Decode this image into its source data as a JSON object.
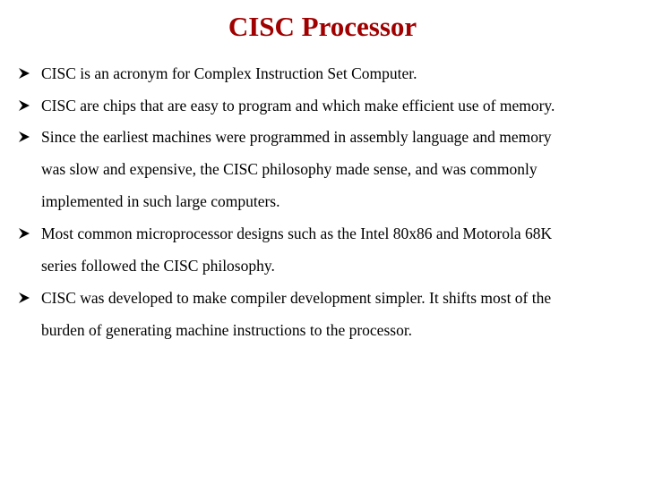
{
  "slide": {
    "title": "CISC Processor",
    "title_color": "#a00000",
    "bullet_icon": "arrowhead-bullet-icon",
    "bullets": [
      {
        "lines": [
          "CISC is an acronym for Complex Instruction Set Computer."
        ]
      },
      {
        "lines": [
          "CISC are chips that are easy to program and which make efficient use of memory."
        ]
      },
      {
        "lines": [
          "Since the earliest machines were programmed in assembly language and memory",
          "was slow and expensive, the CISC philosophy made sense, and was commonly",
          "implemented in such large computers."
        ]
      },
      {
        "lines": [
          "Most common microprocessor designs such as the Intel 80x86 and Motorola 68K",
          "series followed the CISC philosophy."
        ]
      },
      {
        "lines": [
          "CISC was developed to make compiler development simpler. It shifts most of the",
          "burden of generating machine instructions to the processor."
        ]
      }
    ]
  }
}
